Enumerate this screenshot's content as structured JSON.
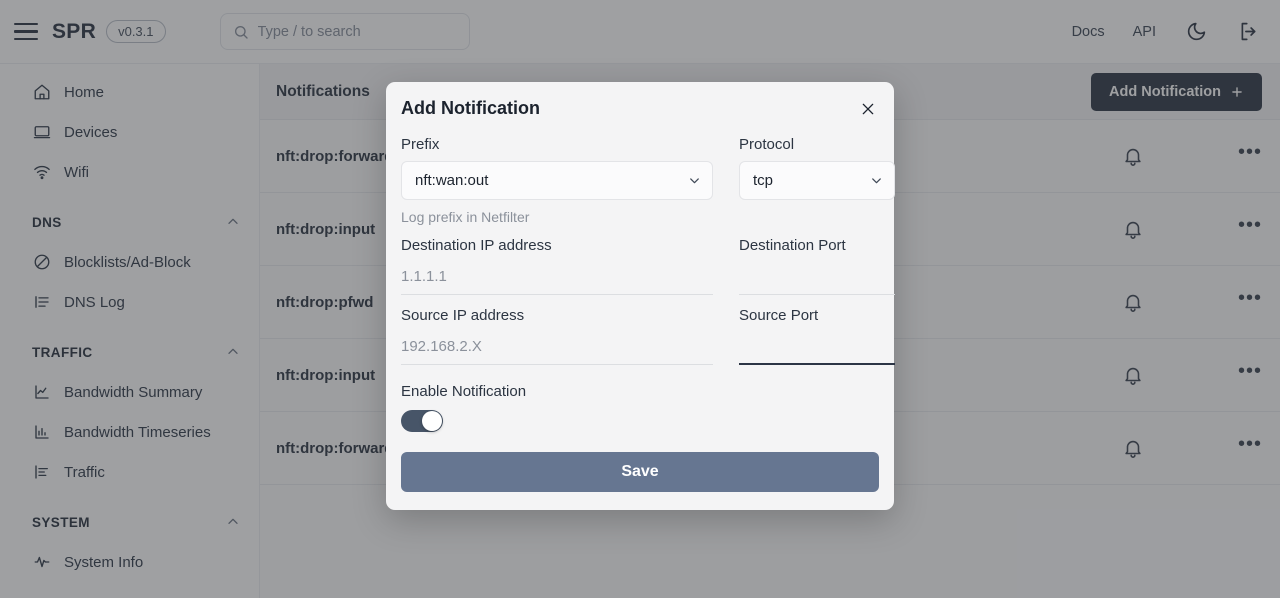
{
  "topbar": {
    "menu_icon": "hamburger-icon",
    "brand": "SPR",
    "version": "v0.3.1",
    "search_placeholder": "Type / to search",
    "search_value": "",
    "search_icon": "search-icon",
    "links": [
      {
        "label": "Docs"
      },
      {
        "label": "API"
      }
    ],
    "theme_icon": "moon-icon",
    "logout_icon": "logout-icon"
  },
  "sidebar": {
    "items": [
      {
        "label": "Home",
        "icon": "home-icon",
        "type": "item"
      },
      {
        "label": "Devices",
        "icon": "laptop-icon",
        "type": "item"
      },
      {
        "label": "Wifi",
        "icon": "wifi-icon",
        "type": "item"
      },
      {
        "label": "DNS",
        "icon": "chevron-up-icon",
        "type": "group"
      },
      {
        "label": "Blocklists/Ad-Block",
        "icon": "ban-icon",
        "type": "item"
      },
      {
        "label": "DNS Log",
        "icon": "list-icon",
        "type": "item"
      },
      {
        "label": "TRAFFIC",
        "icon": "chevron-up-icon",
        "type": "group"
      },
      {
        "label": "Bandwidth Summary",
        "icon": "line-chart-icon",
        "type": "item"
      },
      {
        "label": "Bandwidth Timeseries",
        "icon": "bar-chart-icon",
        "type": "item"
      },
      {
        "label": "Traffic",
        "icon": "bar-chart-h-icon",
        "type": "item"
      },
      {
        "label": "SYSTEM",
        "icon": "chevron-up-icon",
        "type": "group"
      },
      {
        "label": "System Info",
        "icon": "activity-icon",
        "type": "item"
      }
    ]
  },
  "main": {
    "title": "Notifications",
    "add_button": "Add Notification",
    "add_button_icon": "plus-icon",
    "row_bell_icon": "bell-icon",
    "row_menu_icon": "ellipsis-icon",
    "rows": [
      {
        "label": "nft:drop:forward"
      },
      {
        "label": "nft:drop:input"
      },
      {
        "label": "nft:drop:pfwd"
      },
      {
        "label": "nft:drop:input"
      },
      {
        "label": "nft:drop:forward"
      }
    ]
  },
  "modal": {
    "title": "Add Notification",
    "close_icon": "close-icon",
    "prefix": {
      "label": "Prefix",
      "value": "nft:wan:out",
      "helper": "Log prefix in Netfilter",
      "chevron_icon": "chevron-down-icon"
    },
    "protocol": {
      "label": "Protocol",
      "value": "tcp",
      "chevron_icon": "chevron-down-icon"
    },
    "dest_ip": {
      "label": "Destination IP address",
      "placeholder": "1.1.1.1",
      "value": ""
    },
    "dest_port": {
      "label": "Destination Port",
      "placeholder": "",
      "value": ""
    },
    "src_ip": {
      "label": "Source IP address",
      "placeholder": "192.168.2.X",
      "value": ""
    },
    "src_port": {
      "label": "Source Port",
      "placeholder": "",
      "value": ""
    },
    "enable": {
      "label": "Enable Notification",
      "state": "on"
    },
    "save_label": "Save"
  },
  "colors": {
    "accent_dark": "#2c3545",
    "save_button": "#667691",
    "toggle_on": "#475568",
    "overlay": "rgba(52,54,58,0.47)"
  }
}
